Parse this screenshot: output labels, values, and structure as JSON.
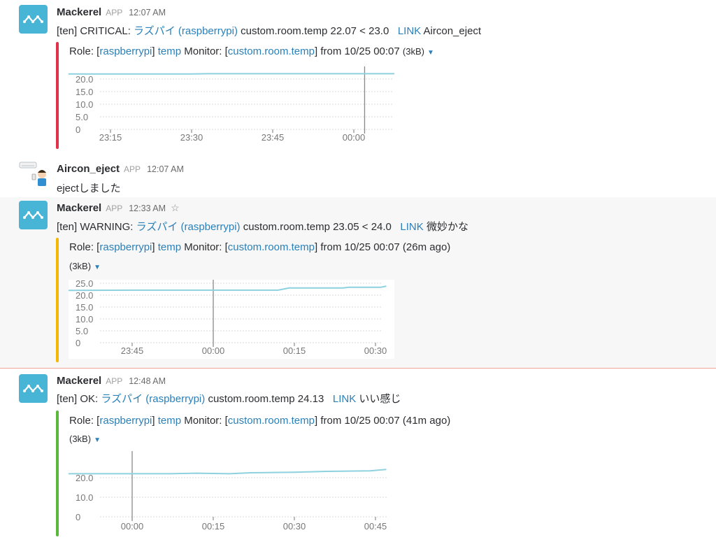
{
  "colors": {
    "critical": "#e0334a",
    "warning": "#f2b700",
    "ok": "#5cb83c",
    "link": "#2a80b9",
    "line": "#8ed1df"
  },
  "messages": [
    {
      "sender": "Mackerel",
      "app": "APP",
      "time": "12:07 AM",
      "prefix": "[ten] CRITICAL: ",
      "host": "ラズパイ (raspberrypi)",
      "metric": "custom.room.temp 22.07 < 23.0",
      "link": "LINK",
      "note": "Aircon_eject",
      "role_a": "Role: [",
      "role_service": "raspberrypi",
      "role_b": "] ",
      "role_name": "temp",
      "monitor_a": " Monitor: [",
      "monitor_name": "custom.room.temp",
      "monitor_b": "] from 10/25 00:07",
      "ago": "",
      "size": "(3kB)"
    },
    {
      "sender": "Aircon_eject",
      "app": "APP",
      "time": "12:07 AM",
      "text": "ejectしました"
    },
    {
      "sender": "Mackerel",
      "app": "APP",
      "time": "12:33 AM",
      "star": "☆",
      "prefix": "[ten] WARNING: ",
      "host": "ラズパイ (raspberrypi)",
      "metric": "custom.room.temp 23.05 < 24.0",
      "link": "LINK",
      "note": "微妙かな",
      "role_a": "Role: [",
      "role_service": "raspberrypi",
      "role_b": "] ",
      "role_name": "temp",
      "monitor_a": " Monitor: [",
      "monitor_name": "custom.room.temp",
      "monitor_b": "] from 10/25 00:07",
      "ago": " (26m ago)",
      "size": "(3kB)"
    },
    {
      "sender": "Mackerel",
      "app": "APP",
      "time": "12:48 AM",
      "prefix": "[ten] OK: ",
      "host": "ラズパイ (raspberrypi)",
      "metric": "custom.room.temp 24.13",
      "link": "LINK",
      "note": "いい感じ",
      "role_a": "Role: [",
      "role_service": "raspberrypi",
      "role_b": "] ",
      "role_name": "temp",
      "monitor_a": " Monitor: [",
      "monitor_name": "custom.room.temp",
      "monitor_b": "] from 10/25 00:07",
      "ago": " (41m ago)",
      "size": "(3kB)"
    }
  ],
  "chart_data": [
    {
      "type": "line",
      "y_ticks": [
        "20.0",
        "15.0",
        "10.0",
        "5.0",
        "0"
      ],
      "x_ticks": [
        "23:15",
        "23:30",
        "23:45",
        "00:00"
      ],
      "ylim": [
        0,
        23
      ],
      "x": [
        "23:07",
        "23:30",
        "23:33",
        "23:45",
        "00:00",
        "00:10"
      ],
      "values": [
        22.0,
        22.0,
        22.1,
        22.1,
        22.1,
        22.1
      ],
      "marker": "00:02"
    },
    {
      "type": "line",
      "y_ticks": [
        "25.0",
        "20.0",
        "15.0",
        "10.0",
        "5.0",
        "0"
      ],
      "x_ticks": [
        "23:45",
        "00:00",
        "00:15",
        "00:30"
      ],
      "ylim": [
        0,
        25
      ],
      "x": [
        "23:33",
        "23:45",
        "00:00",
        "00:12",
        "00:14",
        "00:24",
        "00:25",
        "00:31",
        "00:32"
      ],
      "values": [
        22.0,
        22.1,
        22.1,
        22.1,
        23.0,
        23.0,
        23.3,
        23.3,
        23.8
      ],
      "marker": "00:00"
    },
    {
      "type": "line",
      "y_ticks": [
        "20.0",
        "10.0",
        "0"
      ],
      "x_ticks": [
        "00:00",
        "00:15",
        "00:30",
        "00:45"
      ],
      "ylim": [
        0,
        28
      ],
      "x": [
        "23:47",
        "00:07",
        "00:12",
        "00:18",
        "00:22",
        "00:30",
        "00:36",
        "00:44",
        "00:47"
      ],
      "values": [
        22.0,
        22.0,
        22.3,
        22.0,
        22.5,
        22.8,
        23.2,
        23.5,
        24.2
      ],
      "marker": "00:00"
    }
  ]
}
